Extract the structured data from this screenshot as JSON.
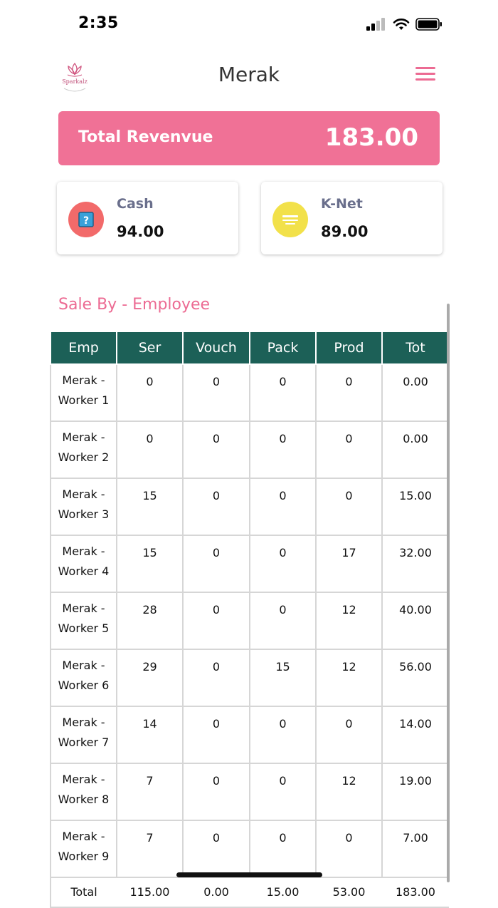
{
  "status": {
    "time": "2:35"
  },
  "header": {
    "title": "Merak",
    "logo_text": "Sparkalz"
  },
  "revenue": {
    "label": "Total Revenvue",
    "value": "183.00"
  },
  "payments": [
    {
      "name": "Cash",
      "amount": "94.00",
      "icon": "cash-icon",
      "color": "#f26a6a"
    },
    {
      "name": "K-Net",
      "amount": "89.00",
      "icon": "knet-icon",
      "color": "#f2e14a"
    }
  ],
  "sales_section": {
    "title": "Sale By - Employee"
  },
  "table": {
    "columns": [
      "Emp",
      "Ser",
      "Vouch",
      "Pack",
      "Prod",
      "Tot"
    ],
    "rows": [
      {
        "emp_line1": "Merak -",
        "emp_line2": "Worker 1",
        "ser": "0",
        "vouch": "0",
        "pack": "0",
        "prod": "0",
        "tot": "0.00"
      },
      {
        "emp_line1": "Merak -",
        "emp_line2": "Worker 2",
        "ser": "0",
        "vouch": "0",
        "pack": "0",
        "prod": "0",
        "tot": "0.00"
      },
      {
        "emp_line1": "Merak -",
        "emp_line2": "Worker 3",
        "ser": "15",
        "vouch": "0",
        "pack": "0",
        "prod": "0",
        "tot": "15.00"
      },
      {
        "emp_line1": "Merak -",
        "emp_line2": "Worker 4",
        "ser": "15",
        "vouch": "0",
        "pack": "0",
        "prod": "17",
        "tot": "32.00"
      },
      {
        "emp_line1": "Merak -",
        "emp_line2": "Worker 5",
        "ser": "28",
        "vouch": "0",
        "pack": "0",
        "prod": "12",
        "tot": "40.00"
      },
      {
        "emp_line1": "Merak -",
        "emp_line2": "Worker 6",
        "ser": "29",
        "vouch": "0",
        "pack": "15",
        "prod": "12",
        "tot": "56.00"
      },
      {
        "emp_line1": "Merak -",
        "emp_line2": "Worker 7",
        "ser": "14",
        "vouch": "0",
        "pack": "0",
        "prod": "0",
        "tot": "14.00"
      },
      {
        "emp_line1": "Merak -",
        "emp_line2": "Worker 8",
        "ser": "7",
        "vouch": "0",
        "pack": "0",
        "prod": "12",
        "tot": "19.00"
      },
      {
        "emp_line1": "Merak -",
        "emp_line2": "Worker 9",
        "ser": "7",
        "vouch": "0",
        "pack": "0",
        "prod": "0",
        "tot": "7.00"
      }
    ],
    "total": {
      "label": "Total",
      "ser": "115.00",
      "vouch": "0.00",
      "pack": "15.00",
      "prod": "53.00",
      "tot": "183.00"
    }
  },
  "colors": {
    "accent": "#f07196",
    "table_header": "#1c6057",
    "card_label": "#6a6f8c"
  }
}
